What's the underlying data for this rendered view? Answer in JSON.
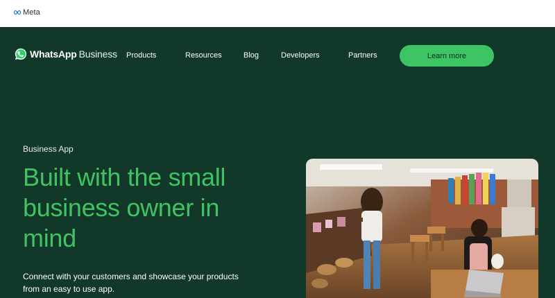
{
  "meta": {
    "brand": "Meta"
  },
  "navbar": {
    "logo_bold": "WhatsApp",
    "logo_light": "Business",
    "links": [
      "Products",
      "Resources",
      "Blog",
      "Developers",
      "Partners"
    ],
    "cta_label": "Learn more"
  },
  "hero": {
    "eyebrow": "Business App",
    "title": "Built with the small business owner in mind",
    "subtitle": "Connect with your customers and showcase your products from an easy to use app."
  },
  "colors": {
    "background": "#12382a",
    "accent_green": "#41c363",
    "cta_green": "#3cc465"
  },
  "icons": [
    "meta-infinity-icon",
    "whatsapp-icon"
  ]
}
